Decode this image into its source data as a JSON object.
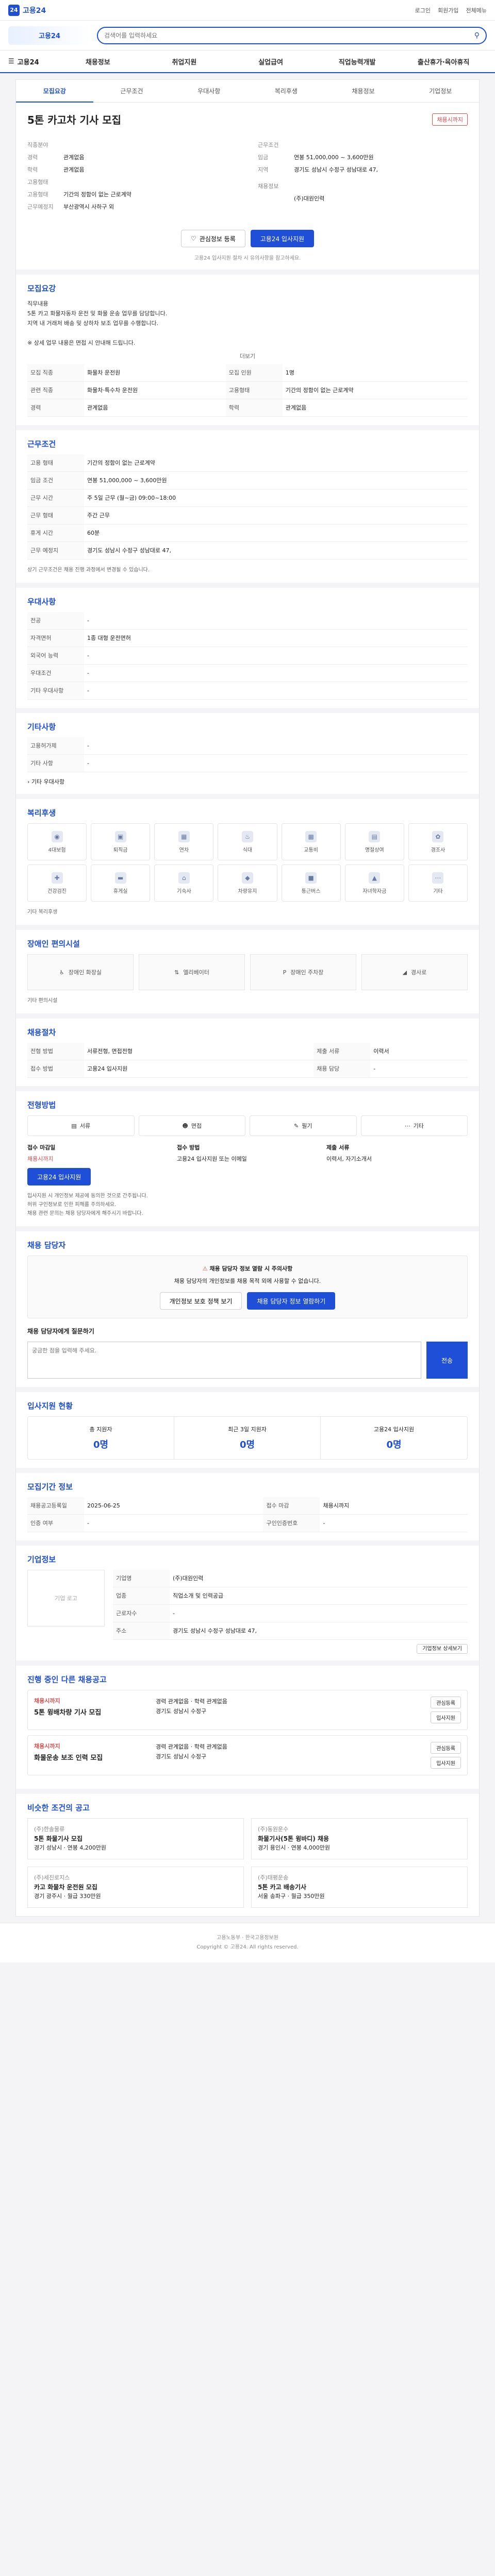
{
  "topbar": {
    "logo": "고용24",
    "menu": [
      "로그인",
      "회원가입",
      "전체메뉴"
    ]
  },
  "banner": {
    "logo": "고용24",
    "search_placeholder": "검색어를 입력하세요"
  },
  "nav": {
    "home": "고용24",
    "items": [
      "채용정보",
      "취업지원",
      "실업급여",
      "직업능력개발",
      "출산휴가·육아휴직"
    ]
  },
  "tabs": [
    "모집요강",
    "근무조건",
    "우대사항",
    "복리후생",
    "채용정보",
    "기업정보"
  ],
  "header": {
    "title": "5톤 카고차 기사 모집",
    "badge": "채용시까지"
  },
  "summary": {
    "left": [
      {
        "k": "직종분야",
        "v": ""
      },
      {
        "k": "경력",
        "v": "관계없음"
      },
      {
        "k": "학력",
        "v": "관계없음"
      },
      {
        "k": "고용형태",
        "v": ""
      },
      {
        "k": "고용형태",
        "v": "기간의 정함이 없는 근로계약"
      },
      {
        "k": "근무예정지",
        "v": "부산광역시 사하구 외"
      }
    ],
    "right": [
      {
        "k": "근무조건",
        "v": ""
      },
      {
        "k": "임금",
        "v": "연봉 51,000,000 ~ 3,600만원"
      },
      {
        "k": "지역",
        "v": "경기도 성남시 수정구 성남대로 47,"
      },
      {
        "k": "",
        "v": ""
      },
      {
        "k": "채용정보",
        "v": ""
      },
      {
        "k": "",
        "v": "(주)대원인력"
      }
    ],
    "save_label": "관심정보 등록",
    "apply_label": "고용24 입사지원",
    "note": "고용24 입사지원 절차 시 유의사항을 참고하세요."
  },
  "recruit": {
    "title": "모집요강",
    "desc": "직무내용\n5톤 카고 화물자동차 운전 및 화물 운송 업무를 담당합니다.\n지역 내 거래처 배송 및 상하차 보조 업무를 수행합니다.\n\n※ 상세 업무 내용은 면접 시 안내해 드립니다.",
    "more": "더보기",
    "rows": [
      {
        "k": "모집 직종",
        "v": "화물차 운전원"
      },
      {
        "k": "모집 인원",
        "v": "1명"
      },
      {
        "k": "관련 직종",
        "v": "화물차·특수차 운전원"
      },
      {
        "k": "고용형태",
        "v": "기간의 정함이 없는 근로계약"
      },
      {
        "k": "경력",
        "v": "관계없음"
      },
      {
        "k": "학력",
        "v": "관계없음"
      }
    ]
  },
  "conditions": {
    "title": "근무조건",
    "rows": [
      {
        "k": "고용 형태",
        "v": "기간의 정함이 없는 근로계약"
      },
      {
        "k": "임금 조건",
        "v": "연봉 51,000,000 ~ 3,600만원"
      },
      {
        "k": "근무 시간",
        "v": "주 5일 근무 (월~금) 09:00~18:00"
      },
      {
        "k": "근무 형태",
        "v": "주간 근무"
      },
      {
        "k": "휴게 시간",
        "v": "60분"
      },
      {
        "k": "근무 예정지",
        "v": "경기도 성남시 수정구 성남대로 47,"
      }
    ],
    "note": "상기 근무조건은 채용 진행 과정에서 변경될 수 있습니다."
  },
  "preference": {
    "title": "우대사항",
    "rows": [
      {
        "k": "전공",
        "v": "-"
      },
      {
        "k": "자격면허",
        "v": "1종 대형 운전면허"
      },
      {
        "k": "외국어 능력",
        "v": "-"
      },
      {
        "k": "우대조건",
        "v": "-"
      },
      {
        "k": "기타 우대사항",
        "v": "-"
      }
    ]
  },
  "other_req": {
    "title": "기타사항",
    "rows": [
      {
        "k": "고용허가제",
        "v": "-"
      },
      {
        "k": "기타 사항",
        "v": "-"
      }
    ],
    "link": "기타 우대사항"
  },
  "benefits": {
    "title": "복리후생",
    "items": [
      "4대보험",
      "퇴직금",
      "연차",
      "식대",
      "교통비",
      "명절상여",
      "경조사",
      "건강검진",
      "휴게실",
      "기숙사",
      "차량유지",
      "통근버스",
      "자녀학자금",
      "기타"
    ],
    "note": "기타 복리후생"
  },
  "disability": {
    "title": "장애인 편의시설",
    "items": [
      "장애인 화장실",
      "엘리베이터",
      "장애인 주차장",
      "경사로"
    ],
    "note": "기타 편의시설"
  },
  "process": {
    "title": "채용절차",
    "rows": [
      {
        "k": "전형 방법",
        "v": "서류전형, 면접전형"
      },
      {
        "k": "제출 서류",
        "v": "이력서"
      },
      {
        "k": "접수 방법",
        "v": "고용24 입사지원"
      },
      {
        "k": "채용 담당",
        "v": "-"
      }
    ]
  },
  "apply": {
    "title": "전형방법",
    "methods": [
      "서류",
      "면접",
      "필기",
      "기타"
    ],
    "deadline_label": "접수 마감일",
    "deadline": "채용시까지",
    "apply_btn": "고용24 입사지원",
    "contact_label": "접수 방법",
    "contact": "고용24 입사지원 또는 이메일",
    "docs_label": "제출 서류",
    "docs": "이력서, 자기소개서",
    "bullets": [
      "입사지원 시 개인정보 제공에 동의한 것으로 간주됩니다.",
      "허위 구인정보로 인한 피해를 주의하세요.",
      "채용 관련 문의는 채용 담당자에게 해주시기 바랍니다."
    ]
  },
  "contact": {
    "title": "채용 담당자",
    "alert_title": "채용 담당자 정보 열람 시 주의사항",
    "alert_desc": "채용 담당자의 개인정보를 채용 목적 외에 사용할 수 없습니다.",
    "btn1": "개인정보 보호 정책 보기",
    "btn2": "채용 담당자 정보 열람하기",
    "qna_title": "채용 담당자에게 질문하기",
    "qna_placeholder": "궁금한 점을 입력해 주세요.",
    "qna_send": "전송"
  },
  "stats": {
    "title": "입사지원 현황",
    "items": [
      {
        "label": "총 지원자",
        "n": "0명"
      },
      {
        "label": "최근 3일 지원자",
        "n": "0명"
      },
      {
        "label": "고용24 입사지원",
        "n": "0명"
      }
    ]
  },
  "period": {
    "title": "모집기간 정보",
    "rows": [
      {
        "k": "채용공고등록일",
        "v": "2025-06-25"
      },
      {
        "k": "접수 마감",
        "v": "채용시까지"
      },
      {
        "k": "인증 여부",
        "v": "-"
      },
      {
        "k": "구인인증번호",
        "v": "-"
      }
    ]
  },
  "company": {
    "title": "기업정보",
    "logo": "기업 로고",
    "rows": [
      {
        "k": "기업명",
        "v": "(주)대원인력"
      },
      {
        "k": "업종",
        "v": "직업소개 및 인력공급"
      },
      {
        "k": "근로자수",
        "v": "-"
      },
      {
        "k": "주소",
        "v": "경기도 성남시 수정구 성남대로 47,"
      }
    ],
    "link": "기업정보 상세보기"
  },
  "others": {
    "title": "진행 중인 다른 채용공고",
    "items": [
      {
        "co": "채용시까지",
        "name": "5톤 윙배차량 기사 모집",
        "meta": "경력 관계없음 · 학력 관계없음",
        "sub": "경기도 성남시 수정구",
        "btn1": "관심등록",
        "btn2": "입사지원"
      },
      {
        "co": "채용시까지",
        "name": "화물운송 보조 인력 모집",
        "meta": "경력 관계없음 · 학력 관계없음",
        "sub": "경기도 성남시 수정구",
        "btn1": "관심등록",
        "btn2": "입사지원"
      }
    ]
  },
  "similar": {
    "title": "비슷한 조건의 공고",
    "items": [
      {
        "co": "(주)한솔물류",
        "name": "5톤 화물기사 모집",
        "meta": "경기 성남시 · 연봉 4,200만원"
      },
      {
        "co": "(주)동원운수",
        "name": "화물기사(5톤 윙바디) 채용",
        "meta": "경기 용인시 · 연봉 4,000만원"
      },
      {
        "co": "(주)세진로지스",
        "name": "카고 화물차 운전원 모집",
        "meta": "경기 광주시 · 월급 330만원"
      },
      {
        "co": "(주)태평운송",
        "name": "5톤 카고 배송기사",
        "meta": "서울 송파구 · 월급 350만원"
      }
    ]
  },
  "footer": {
    "line1": "고용노동부 · 한국고용정보원",
    "line2": "Copyright © 고용24. All rights reserved."
  }
}
